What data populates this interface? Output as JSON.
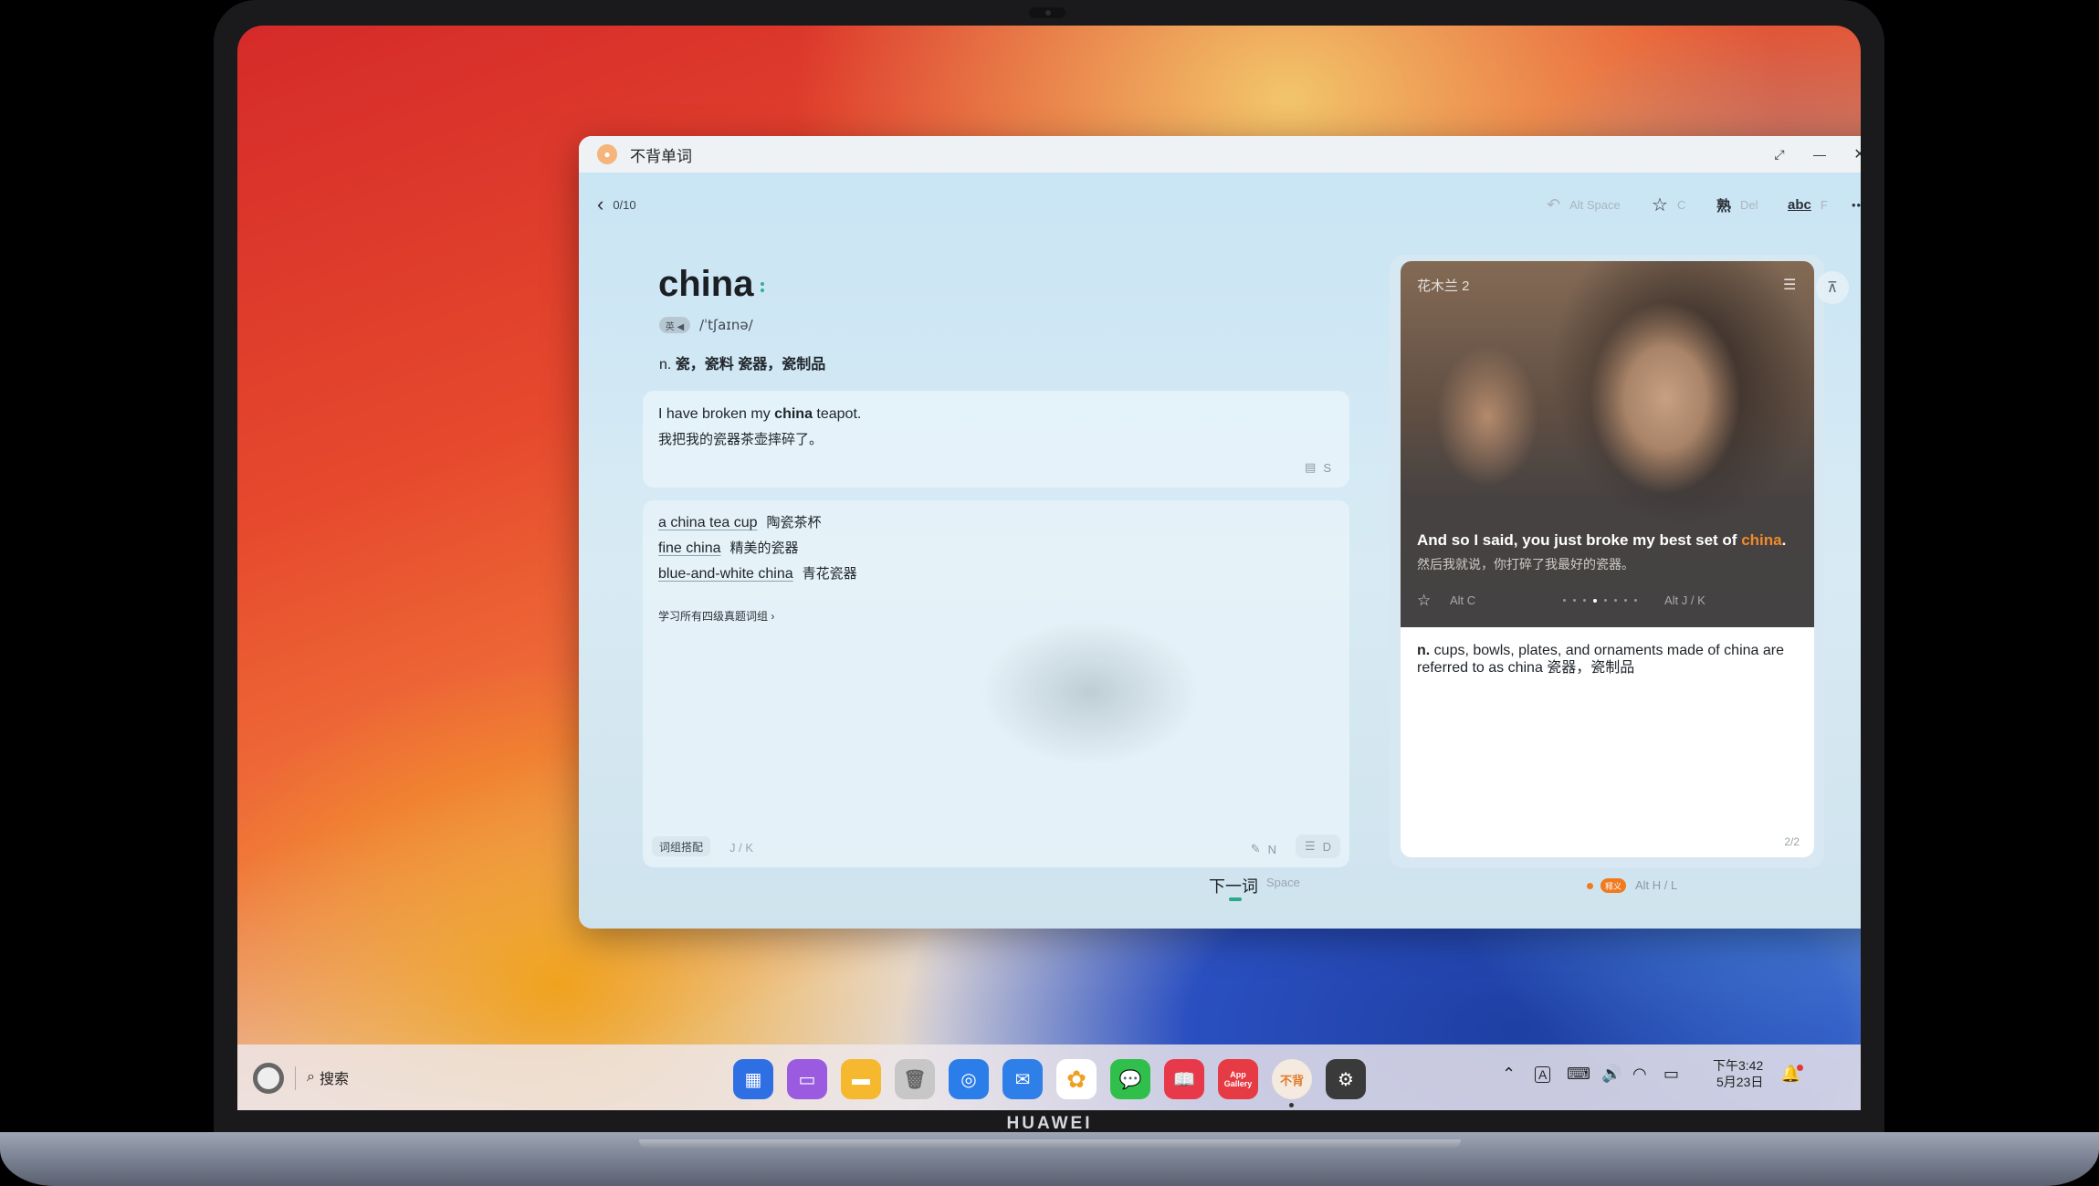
{
  "device": {
    "brand": "HUAWEI"
  },
  "window": {
    "title": "不背单词",
    "controls": {
      "restore": "⤢",
      "minimize": "—",
      "close": "✕"
    }
  },
  "toolbar": {
    "progress": "0/10",
    "undo_key": "Alt Space",
    "star_key": "C",
    "familiar_icon": "熟",
    "familiar_key": "Del",
    "spell_icon": "abc",
    "spell_key": "F",
    "more": "•••"
  },
  "word": {
    "text": "china",
    "accent": "英 ◀",
    "phonetic": "/ˈtʃaɪnə/",
    "pos": "n.",
    "meaning": "瓷，瓷料  瓷器，瓷制品"
  },
  "example": {
    "en_before": "I have broken my ",
    "en_word": "china",
    "en_after": " teapot.",
    "zh": "我把我的瓷器茶壶摔碎了。",
    "key": "S"
  },
  "phrases": {
    "items": [
      {
        "en": "a china tea cup",
        "zh": "陶瓷茶杯"
      },
      {
        "en": "fine china",
        "zh": "精美的瓷器"
      },
      {
        "en": "blue-and-white china",
        "zh": "青花瓷器"
      }
    ],
    "learn_link": "学习所有四级真题词组 ›",
    "tag": "词组搭配",
    "tag_keys": "J / K",
    "note_key": "N",
    "dict_key": "D"
  },
  "next": {
    "label": "下一词",
    "key": "Space"
  },
  "video": {
    "title": "花木兰 2",
    "subtitle_en_before": "And so I said, you just broke my best set of ",
    "subtitle_en_word": "china",
    "subtitle_en_after": ".",
    "subtitle_zh": "然后我就说，你打碎了我最好的瓷器。",
    "star_key": "Alt C",
    "nav_key": "Alt J / K",
    "dots_total": 8,
    "dots_active": 4
  },
  "definition": {
    "pos": "n.",
    "text": "cups, bowls, plates, and ornaments made of china are referred to as china  瓷器，瓷制品",
    "page": "2/2"
  },
  "bottom": {
    "badge": "释义",
    "key": "Alt H / L"
  },
  "taskbar": {
    "search": "搜索",
    "apps": [
      {
        "name": "launcher",
        "glyph": "▦",
        "color": "#2f6fe4"
      },
      {
        "name": "multitask",
        "glyph": "▭",
        "color": "#9a5be0"
      },
      {
        "name": "files",
        "glyph": "▬",
        "color": "#f5b82e"
      },
      {
        "name": "trash",
        "glyph": "🗑",
        "color": "#c7c7c7"
      },
      {
        "name": "browser",
        "glyph": "◎",
        "color": "#2b7de9"
      },
      {
        "name": "mail",
        "glyph": "✉",
        "color": "#2f7fe8"
      },
      {
        "name": "gallery",
        "glyph": "✿",
        "color": "#ffffff"
      },
      {
        "name": "messages",
        "glyph": "💬",
        "color": "#2fbf4a"
      },
      {
        "name": "books",
        "glyph": "📖",
        "color": "#e8394a"
      },
      {
        "name": "appgallery",
        "glyph": "App Gallery",
        "color": "#e63a44"
      },
      {
        "name": "bubei",
        "glyph": "不背",
        "color": "#f4eadf"
      },
      {
        "name": "settings",
        "glyph": "⚙",
        "color": "#3a3a3a"
      }
    ],
    "time": "下午3:42",
    "date": "5月23日"
  }
}
